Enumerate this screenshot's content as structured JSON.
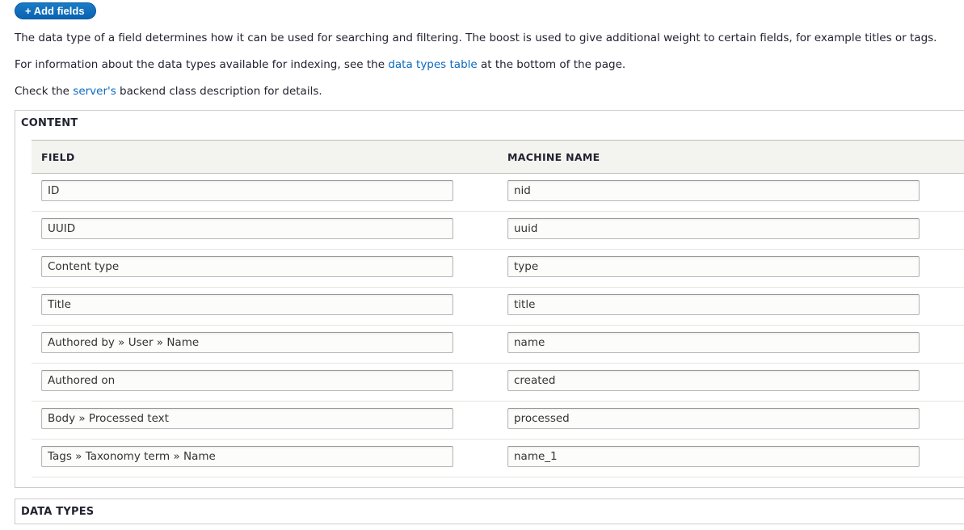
{
  "toolbar": {
    "add_fields_label": "+ Add fields"
  },
  "description": {
    "p1": "The data type of a field determines how it can be used for searching and filtering. The boost is used to give additional weight to certain fields, for example titles or tags.",
    "p2_before": "For information about the data types available for indexing, see the ",
    "p2_link": "data types table",
    "p2_after": " at the bottom of the page.",
    "p3_before": "Check the ",
    "p3_link": "server's",
    "p3_after": " backend class description for details."
  },
  "content_section": {
    "legend": "CONTENT",
    "columns": {
      "field": "FIELD",
      "machine_name": "MACHINE NAME"
    },
    "rows": [
      {
        "field": "ID",
        "machine_name": "nid"
      },
      {
        "field": "UUID",
        "machine_name": "uuid"
      },
      {
        "field": "Content type",
        "machine_name": "type"
      },
      {
        "field": "Title",
        "machine_name": "title"
      },
      {
        "field": "Authored by » User » Name",
        "machine_name": "name"
      },
      {
        "field": "Authored on",
        "machine_name": "created"
      },
      {
        "field": "Body » Processed text",
        "machine_name": "processed"
      },
      {
        "field": "Tags » Taxonomy term » Name",
        "machine_name": "name_1"
      }
    ]
  },
  "data_types_section": {
    "legend": "DATA TYPES"
  },
  "colors": {
    "link": "#0b6bbf",
    "button": "#0a62b0",
    "header_bg": "#f3f3f0"
  }
}
